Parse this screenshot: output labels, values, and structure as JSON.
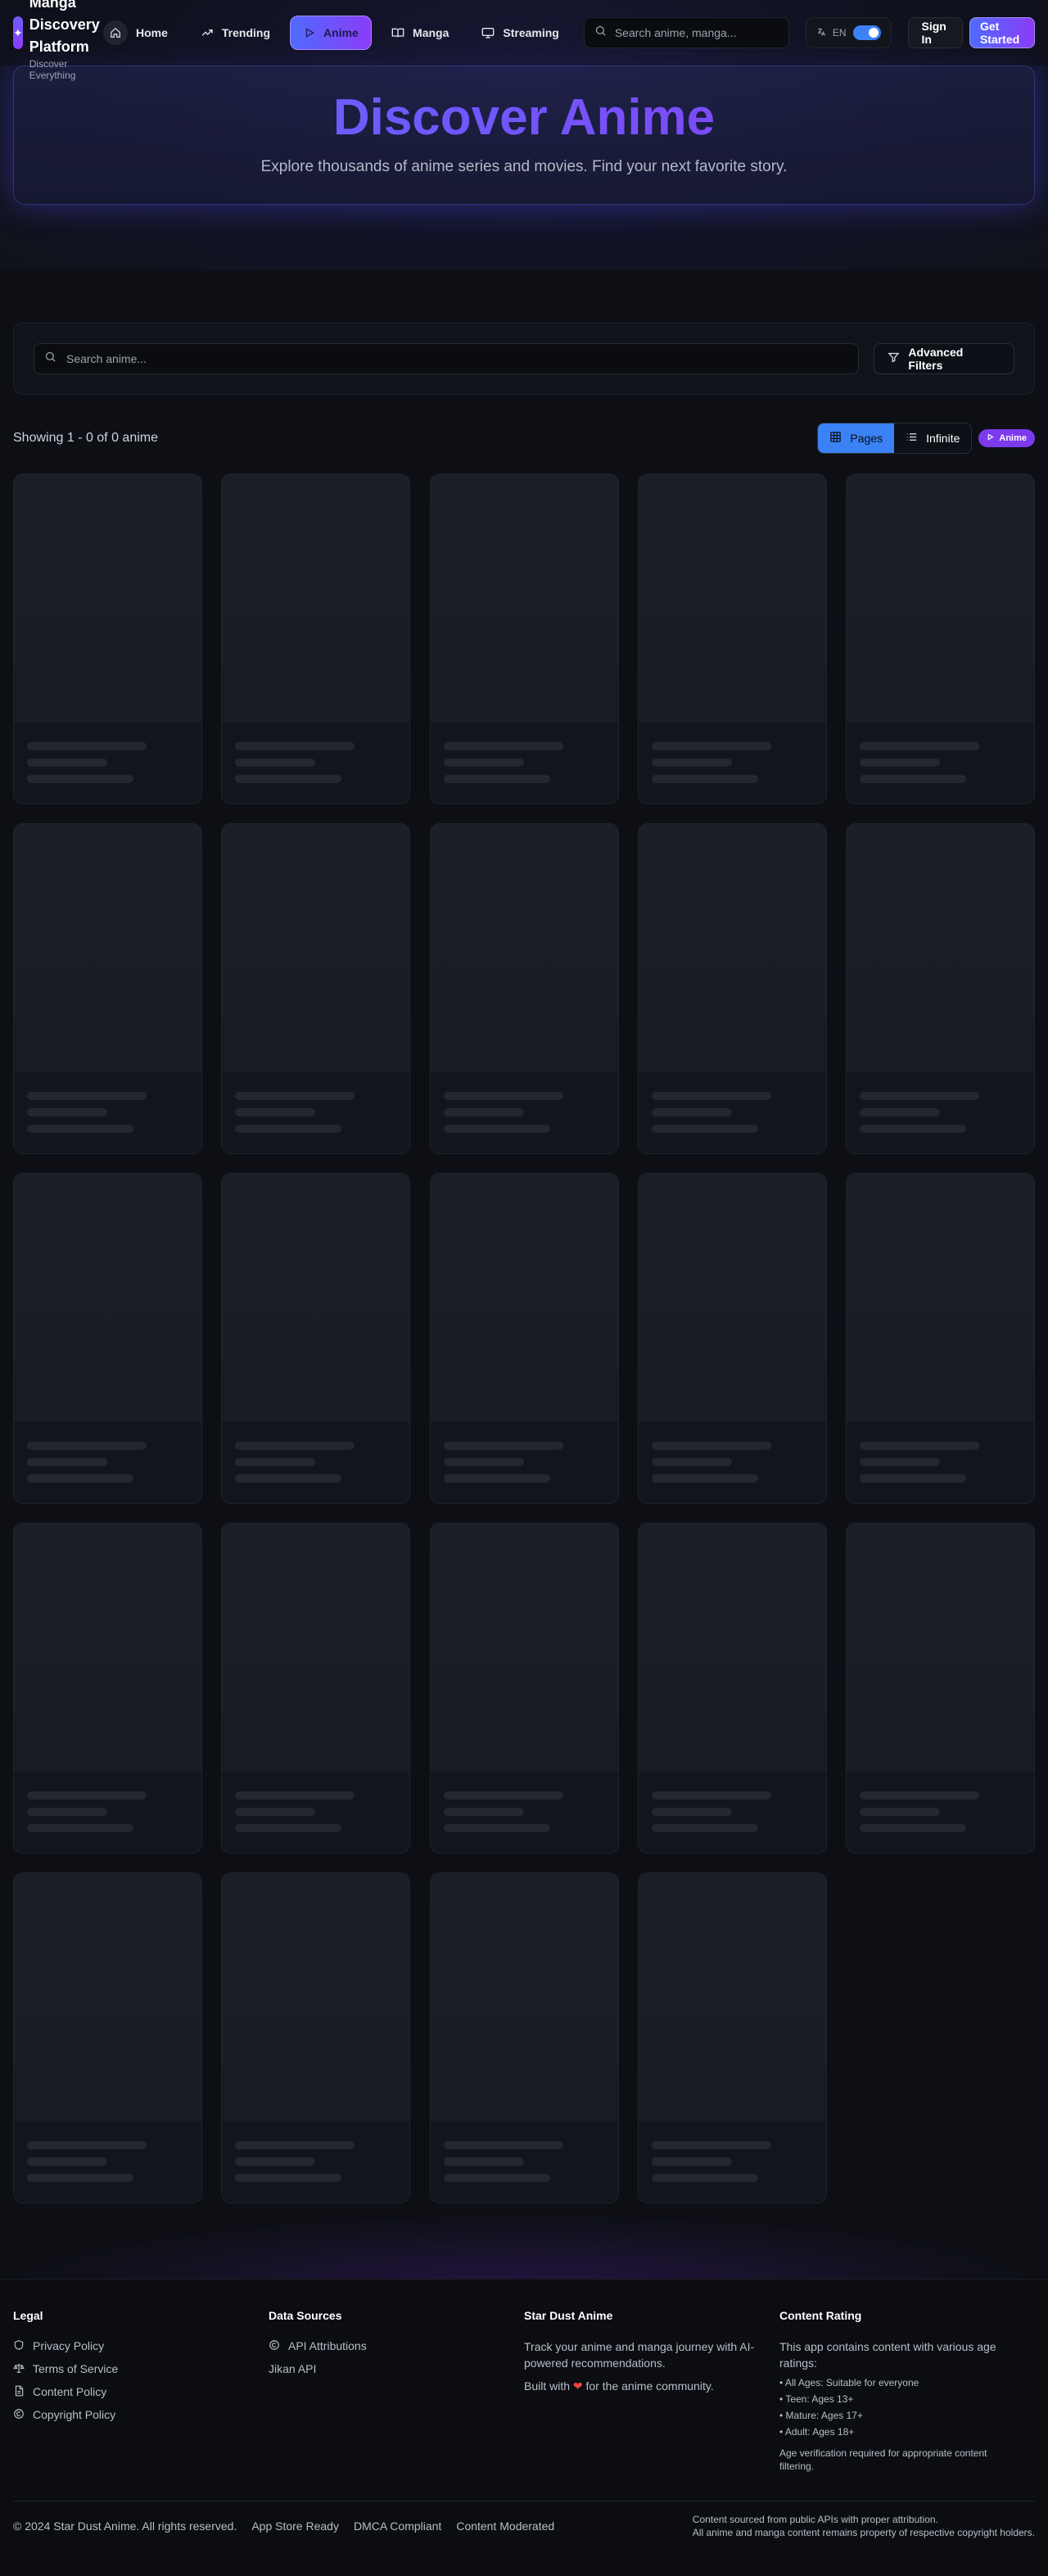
{
  "brand": {
    "title": "Manga Discovery Platform",
    "subtitle": "Discover Everything"
  },
  "nav": {
    "items": [
      {
        "label": "Home",
        "icon": "home-icon"
      },
      {
        "label": "Trending",
        "icon": "trending-icon"
      },
      {
        "label": "Anime",
        "icon": "play-icon",
        "active": true
      },
      {
        "label": "Manga",
        "icon": "book-icon"
      },
      {
        "label": "Streaming",
        "icon": "monitor-icon"
      }
    ],
    "search_placeholder": "Search anime, manga...",
    "language": "EN",
    "sign_in": "Sign In",
    "get_started": "Get Started"
  },
  "hero": {
    "title": "Discover Anime",
    "subtitle": "Explore thousands of anime series and movies. Find your next favorite story."
  },
  "filter": {
    "search_placeholder": "Search anime...",
    "advanced": "Advanced Filters"
  },
  "results": {
    "showing": "Showing 1 - 0 of 0 anime",
    "view_pages": "Pages",
    "view_infinite": "Infinite",
    "badge": "Anime"
  },
  "footer": {
    "legal": {
      "title": "Legal",
      "links": [
        "Privacy Policy",
        "Terms of Service",
        "Content Policy",
        "Copyright Policy"
      ]
    },
    "data_sources": {
      "title": "Data Sources",
      "links": [
        "API Attributions",
        "Jikan API"
      ]
    },
    "about": {
      "title": "Star Dust Anime",
      "text": "Track your anime and manga journey with AI-powered recommendations.",
      "built_prefix": "Built with",
      "built_suffix": "for the anime community."
    },
    "content_rating": {
      "title": "Content Rating",
      "intro": "This app contains content with various age ratings:",
      "items": [
        "• All Ages: Suitable for everyone",
        "• Teen: Ages 13+",
        "• Mature: Ages 17+",
        "• Adult: Ages 18+"
      ],
      "note": "Age verification required for appropriate content filtering."
    },
    "bottom": {
      "copyright": "© 2024 Star Dust Anime. All rights reserved.",
      "badges": [
        "App Store Ready",
        "DMCA Compliant",
        "Content Moderated"
      ],
      "source_line1": "Content sourced from public APIs with proper attribution.",
      "source_line2": "All anime and manga content remains property of respective copyright holders."
    }
  },
  "colors": {
    "accent_blue": "#4f6bff",
    "accent_purple": "#8b3cf6",
    "toggle_blue": "#3b82f6",
    "badge_purple": "#7c3aed"
  }
}
